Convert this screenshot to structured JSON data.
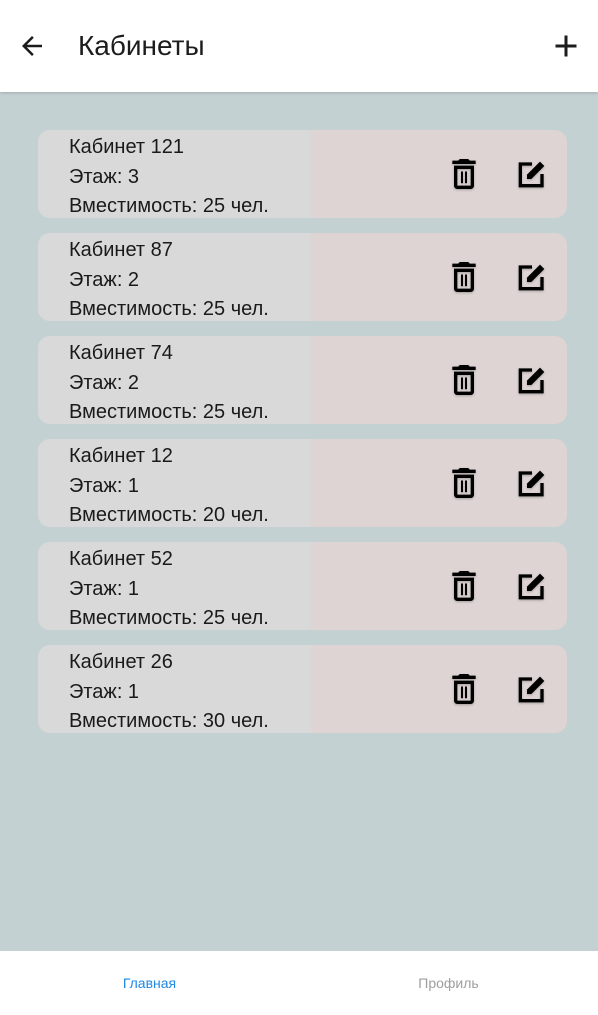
{
  "header": {
    "title": "Кабинеты",
    "back_icon": "arrow-left-icon",
    "add_icon": "plus-icon"
  },
  "rooms": [
    {
      "name": "Кабинет 121",
      "floor": "Этаж: 3",
      "capacity": "Вместимость: 25 чел."
    },
    {
      "name": "Кабинет 87",
      "floor": "Этаж: 2",
      "capacity": "Вместимость: 25 чел."
    },
    {
      "name": "Кабинет 74",
      "floor": "Этаж: 2",
      "capacity": "Вместимость: 25 чел."
    },
    {
      "name": "Кабинет 12",
      "floor": "Этаж: 1",
      "capacity": "Вместимость: 20 чел."
    },
    {
      "name": "Кабинет 52",
      "floor": "Этаж: 1",
      "capacity": "Вместимость: 25 чел."
    },
    {
      "name": "Кабинет 26",
      "floor": "Этаж: 1",
      "capacity": "Вместимость: 30 чел."
    }
  ],
  "card_icons": {
    "delete": "trash-icon",
    "edit": "edit-square-icon"
  },
  "bottom_nav": {
    "items": [
      {
        "label": "Главная",
        "active": true
      },
      {
        "label": "Профиль",
        "active": false
      }
    ]
  },
  "colors": {
    "background": "#c4d1d2",
    "card_left": "#d9d9d9",
    "card_right": "#ddd4d3",
    "accent": "#1e88e5",
    "inactive": "#9e9e9e"
  }
}
